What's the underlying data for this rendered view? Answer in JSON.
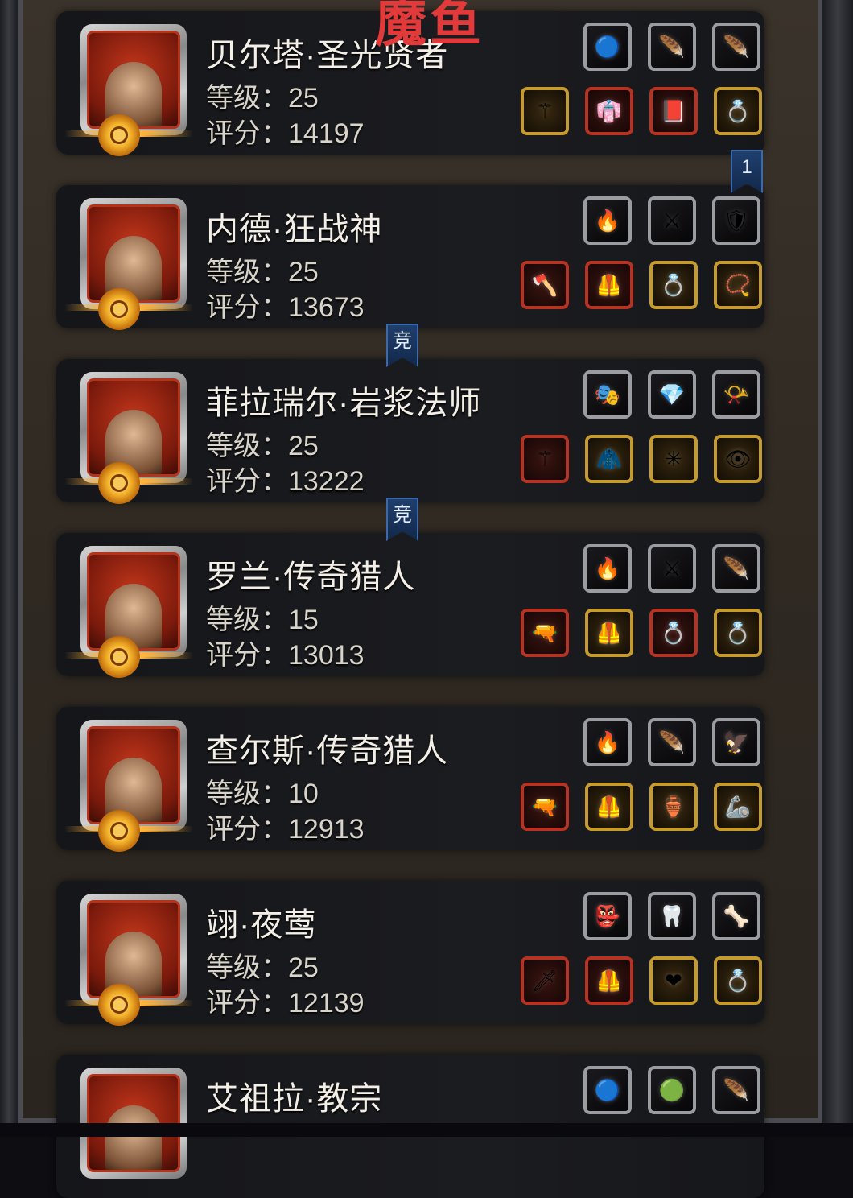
{
  "watermark": "魔鱼",
  "labels": {
    "level": "等级：",
    "score": "评分："
  },
  "heroes": [
    {
      "name": "贝尔塔·圣光贤者",
      "level": "25",
      "score": "14197",
      "top_items": [
        {
          "icon": "blue-orb-icon",
          "glyph": "🔵",
          "tier": "top"
        },
        {
          "icon": "white-wing-icon",
          "glyph": "🪶",
          "tier": "top"
        },
        {
          "icon": "white-wing-icon",
          "glyph": "🪶",
          "tier": "top"
        }
      ],
      "gear": [
        {
          "icon": "staff-icon",
          "glyph": "⚚",
          "tier": "gold"
        },
        {
          "icon": "robe-icon",
          "glyph": "👘",
          "tier": "red"
        },
        {
          "icon": "tome-icon",
          "glyph": "📕",
          "tier": "red"
        },
        {
          "icon": "purple-ring-icon",
          "glyph": "💍",
          "tier": "gold"
        }
      ]
    },
    {
      "name": "内德·狂战神",
      "level": "25",
      "score": "13673",
      "top_items": [
        {
          "icon": "fire-rune-icon",
          "glyph": "🔥",
          "tier": "top"
        },
        {
          "icon": "crossed-swords-emblem-icon",
          "glyph": "⚔",
          "tier": "top"
        },
        {
          "icon": "shield-crest-icon",
          "glyph": "🛡",
          "tier": "top"
        }
      ],
      "gear": [
        {
          "icon": "battle-axe-icon",
          "glyph": "🪓",
          "tier": "red"
        },
        {
          "icon": "green-armor-icon",
          "glyph": "🦺",
          "tier": "red"
        },
        {
          "icon": "gold-ring-icon",
          "glyph": "💍",
          "tier": "gold"
        },
        {
          "icon": "amulet-icon",
          "glyph": "📿",
          "tier": "gold"
        }
      ]
    },
    {
      "name": "菲拉瑞尔·岩浆法师",
      "level": "25",
      "score": "13222",
      "top_items": [
        {
          "icon": "golden-mask-icon",
          "glyph": "🎭",
          "tier": "top"
        },
        {
          "icon": "purple-gem-icon",
          "glyph": "💎",
          "tier": "top"
        },
        {
          "icon": "horn-icon",
          "glyph": "📯",
          "tier": "top"
        }
      ],
      "gear": [
        {
          "icon": "dark-staff-icon",
          "glyph": "⚚",
          "tier": "red"
        },
        {
          "icon": "cloak-icon",
          "glyph": "🧥",
          "tier": "gold"
        },
        {
          "icon": "green-crystal-icon",
          "glyph": "✳",
          "tier": "gold"
        },
        {
          "icon": "eye-amulet-icon",
          "glyph": "👁",
          "tier": "gold"
        }
      ]
    },
    {
      "name": "罗兰·传奇猎人",
      "level": "15",
      "score": "13013",
      "top_items": [
        {
          "icon": "fire-rune-icon",
          "glyph": "🔥",
          "tier": "top"
        },
        {
          "icon": "crossed-swords-emblem-icon",
          "glyph": "⚔",
          "tier": "top"
        },
        {
          "icon": "dark-feather-icon",
          "glyph": "🪶",
          "tier": "top"
        }
      ],
      "gear": [
        {
          "icon": "rifle-icon",
          "glyph": "🔫",
          "tier": "red"
        },
        {
          "icon": "plate-armor-icon",
          "glyph": "🦺",
          "tier": "gold"
        },
        {
          "icon": "blue-ring-icon",
          "glyph": "💍",
          "tier": "red"
        },
        {
          "icon": "silver-ring-icon",
          "glyph": "💍",
          "tier": "gold"
        }
      ]
    },
    {
      "name": "查尔斯·传奇猎人",
      "level": "10",
      "score": "12913",
      "top_items": [
        {
          "icon": "fire-rune-icon",
          "glyph": "🔥",
          "tier": "top"
        },
        {
          "icon": "dark-feather-icon",
          "glyph": "🪶",
          "tier": "top"
        },
        {
          "icon": "claw-icon",
          "glyph": "🦅",
          "tier": "top"
        }
      ],
      "gear": [
        {
          "icon": "pistol-icon",
          "glyph": "🔫",
          "tier": "red"
        },
        {
          "icon": "purple-armor-icon",
          "glyph": "🦺",
          "tier": "gold"
        },
        {
          "icon": "bronze-relic-icon",
          "glyph": "🏺",
          "tier": "gold"
        },
        {
          "icon": "bracer-icon",
          "glyph": "🦾",
          "tier": "gold"
        }
      ]
    },
    {
      "name": "翊·夜莺",
      "level": "25",
      "score": "12139",
      "top_items": [
        {
          "icon": "green-mask-icon",
          "glyph": "👺",
          "tier": "top"
        },
        {
          "icon": "white-tusk-icon",
          "glyph": "🦷",
          "tier": "top"
        },
        {
          "icon": "bone-icon",
          "glyph": "🦴",
          "tier": "top"
        }
      ],
      "gear": [
        {
          "icon": "dagger-icon",
          "glyph": "🗡",
          "tier": "red"
        },
        {
          "icon": "purple-chest-armor-icon",
          "glyph": "🦺",
          "tier": "red"
        },
        {
          "icon": "heart-necklace-icon",
          "glyph": "❤",
          "tier": "gold"
        },
        {
          "icon": "violet-ring-icon",
          "glyph": "💍",
          "tier": "gold"
        }
      ]
    },
    {
      "name": "艾祖拉·教宗",
      "level": "",
      "score": "",
      "top_items": [
        {
          "icon": "blue-orb-icon",
          "glyph": "🔵",
          "tier": "top"
        },
        {
          "icon": "green-stone-icon",
          "glyph": "🟢",
          "tier": "top"
        },
        {
          "icon": "dark-feather-icon",
          "glyph": "🪶",
          "tier": "top"
        }
      ],
      "gear": []
    }
  ],
  "ribbons": [
    {
      "label": "1",
      "name": "rank-ribbon-1"
    },
    {
      "label": "竞",
      "name": "arena-ribbon"
    },
    {
      "label": "竞",
      "name": "arena-ribbon"
    }
  ]
}
